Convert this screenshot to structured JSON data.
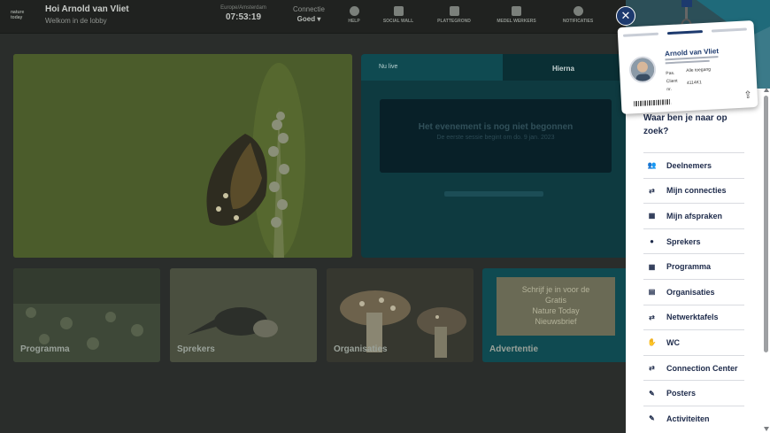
{
  "header": {
    "logo_text": "nature today",
    "greeting": "Hoi Arnold van Vliet",
    "subtitle": "Welkom in de lobby",
    "clock_label": "Europe/Amsterdam",
    "clock_value": "07:53:19",
    "connection_label": "Connectie",
    "connection_value": "Goed",
    "nav": [
      {
        "label": "HELP",
        "icon": "help-icon"
      },
      {
        "label": "SOCIAL WALL",
        "icon": "social-wall-icon"
      },
      {
        "label": "PLATTEGROND",
        "icon": "map-icon"
      },
      {
        "label": "MEDEL WERKERS",
        "icon": "people-icon"
      },
      {
        "label": "NOTIFICATIES",
        "icon": "bell-icon"
      }
    ]
  },
  "live": {
    "tab_nolive": "Nu live",
    "tab_straks": "Hierna",
    "message_title": "Het evenement is nog niet begonnen",
    "message_detail": "De eerste sessie begint om do. 9 jan. 2023"
  },
  "tiles": [
    {
      "label": "Programma"
    },
    {
      "label": "Sprekers"
    },
    {
      "label": "Organisaties"
    },
    {
      "label": "Advertentie"
    }
  ],
  "advert": {
    "line1": "Schrijf je in voor de",
    "line2": "Gratis",
    "line3": "Nature Today",
    "line4": "Nieuwsbrief"
  },
  "badge": {
    "name": "Arnold van Vliet",
    "pas_label": "Pas.",
    "pas_value": "Alle toegang",
    "client_label": "Client",
    "client_value": "4114K1",
    "nr_label": "nr."
  },
  "panel": {
    "question": "Waar ben je naar op zoek?",
    "items": [
      {
        "label": "Deelnemers",
        "icon": "people-icon"
      },
      {
        "label": "Mijn connecties",
        "icon": "handshake-icon"
      },
      {
        "label": "Mijn afspraken",
        "icon": "calendar-icon"
      },
      {
        "label": "Sprekers",
        "icon": "microphone-icon"
      },
      {
        "label": "Programma",
        "icon": "calendar-icon"
      },
      {
        "label": "Organisaties",
        "icon": "store-icon"
      },
      {
        "label": "Netwerktafels",
        "icon": "handshake-icon"
      },
      {
        "label": "WC",
        "icon": "hand-icon"
      },
      {
        "label": "Connection Center",
        "icon": "handshake-icon"
      },
      {
        "label": "Posters",
        "icon": "pencil-icon"
      },
      {
        "label": "Activiteiten",
        "icon": "pencil-icon"
      }
    ]
  },
  "colors": {
    "panel_text": "#1d2a4a",
    "accent_blue": "#1d3a6e",
    "live_bg": "#0e3a40"
  }
}
